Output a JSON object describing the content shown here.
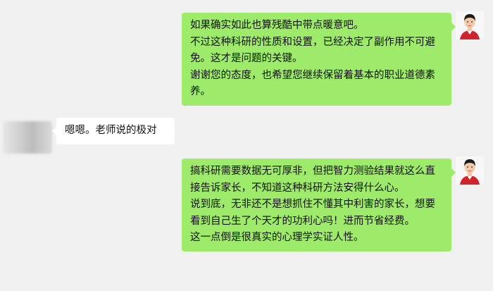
{
  "chat": {
    "messages": [
      {
        "sender": "me",
        "text": "如果确实如此也算残酷中带点暖意吧。\n不过这种科研的性质和设置，已经决定了副作用不可避免。这才是问题的关键。\n谢谢您的态度，也希望您继续保留着基本的职业道德素养。"
      },
      {
        "sender": "other",
        "text": "嗯嗯。老师说的极对"
      },
      {
        "sender": "me",
        "text": "搞科研需要数据无可厚非，但把智力测验结果就这么直接告诉家长，不知道这种科研方法安得什么心。\n说到底，无非还不是想抓住不懂其中利害的家长，想要看到自己生了个天才的功利心吗！进而节省经费。\n这一点倒是很真实的心理学实证人性。"
      }
    ]
  },
  "colors": {
    "background": "#f0f0f0",
    "my_bubble": "#9eea6a",
    "their_bubble": "#ffffff"
  }
}
